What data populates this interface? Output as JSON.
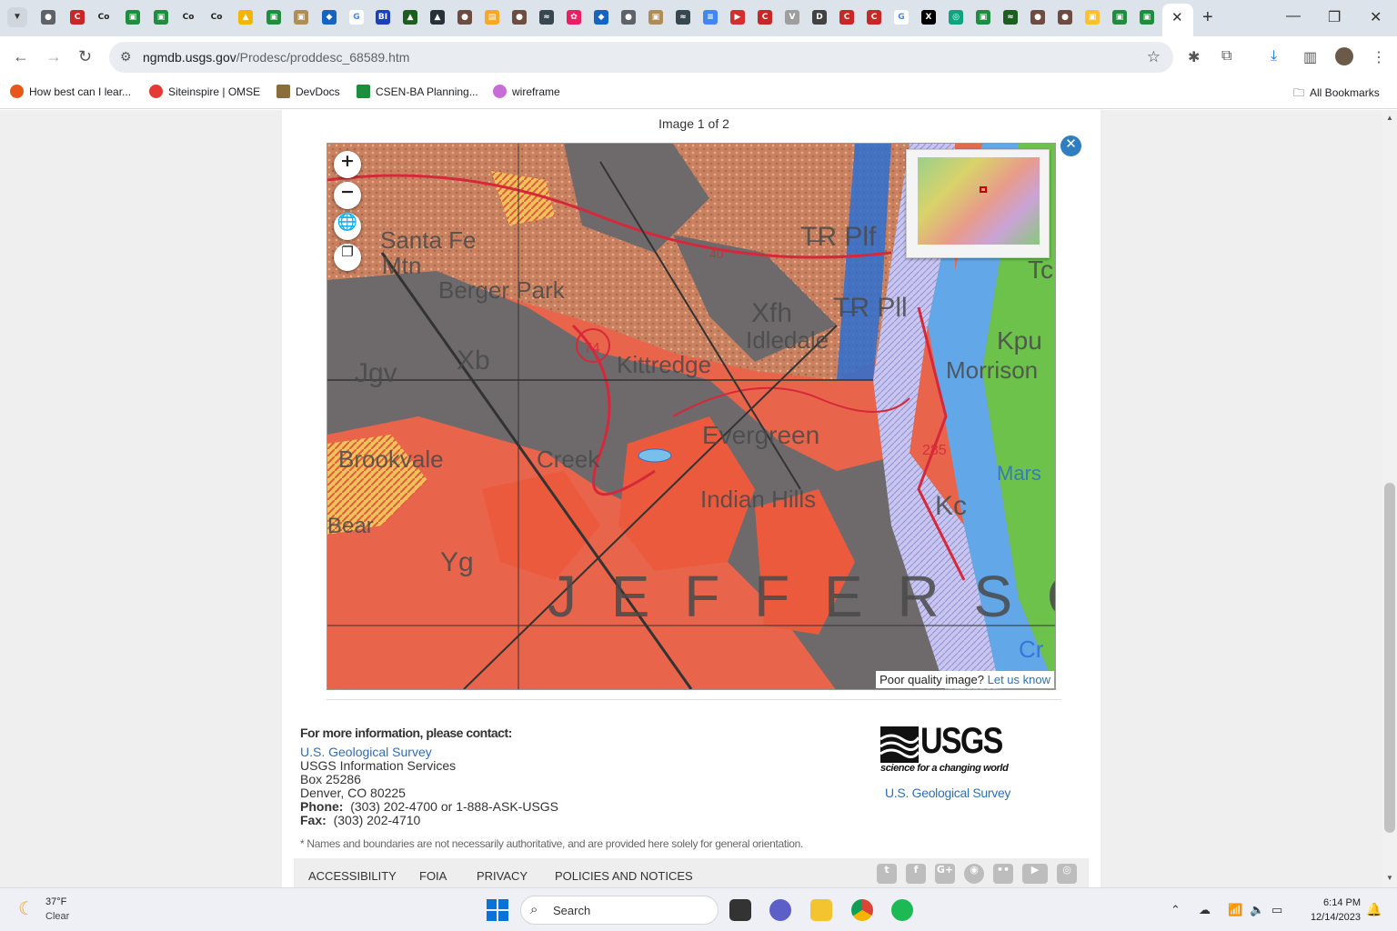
{
  "browser": {
    "url_domain": "ngmdb.usgs.gov",
    "url_path": "/Prodesc/proddesc_68589.htm",
    "tab_favicons": [
      "🌐",
      "Co",
      "Co",
      "Co",
      "Co",
      "G",
      "BI",
      "X"
    ],
    "bookmarks": [
      {
        "label": "How best can I lear...",
        "color": "#e8571a"
      },
      {
        "label": "Siteinspire | OMSE",
        "color": "#e53935"
      },
      {
        "label": "DevDocs",
        "color": "#8a6d3b"
      },
      {
        "label": "CSEN-BA Planning...",
        "color": "#1e8e3e"
      },
      {
        "label": "wireframe",
        "color": "#c86dd7"
      }
    ],
    "all_bookmarks_label": "All Bookmarks"
  },
  "viewer": {
    "image_counter": "Image 1 of 2",
    "zoom_in": "+",
    "zoom_out": "−",
    "poor_quality_text": "Poor quality image?",
    "poor_quality_link": "Let us know",
    "map_labels": [
      "Santa Fe",
      "Mtn",
      "Berger Park",
      "Xb",
      "Jgv",
      "Kittredge",
      "74",
      "Idledale",
      "Xfh",
      "T̶R Plf",
      "T̶R Pll",
      "Kpu",
      "Morrison",
      "Brookvale",
      "Creek",
      "Evergreen",
      "285",
      "Indian Hills",
      "Kc",
      "Mars",
      "Bear",
      "Yg",
      "J E F F E R S O",
      "Tc",
      "40",
      "Cr"
    ]
  },
  "contact": {
    "heading": "For more information, please contact:",
    "org_link": "U.S. Geological Survey",
    "line1": "USGS Information Services",
    "line2": "Box 25286",
    "line3": "Denver, CO 80225",
    "phone_label": "Phone:",
    "phone_value": "(303) 202-4700 or 1-888-ASK-USGS",
    "fax_label": "Fax:",
    "fax_value": "(303) 202-4710",
    "disclaimer": "* Names and boundaries are not necessarily authoritative, and are provided here solely for general orientation."
  },
  "logo": {
    "wordmark": "USGS",
    "tagline": "science for a changing world",
    "link": "U.S. Geological Survey"
  },
  "footer": {
    "links": [
      "ACCESSIBILITY",
      "FOIA",
      "PRIVACY",
      "POLICIES AND NOTICES"
    ],
    "social": [
      "twitter-icon",
      "facebook-icon",
      "google-plus-icon",
      "github-icon",
      "flickr-icon",
      "youtube-icon",
      "instagram-icon"
    ]
  },
  "taskbar": {
    "weather_temp": "37°F",
    "weather_desc": "Clear",
    "search_label": "Search",
    "time": "6:14 PM",
    "date": "12/14/2023"
  }
}
